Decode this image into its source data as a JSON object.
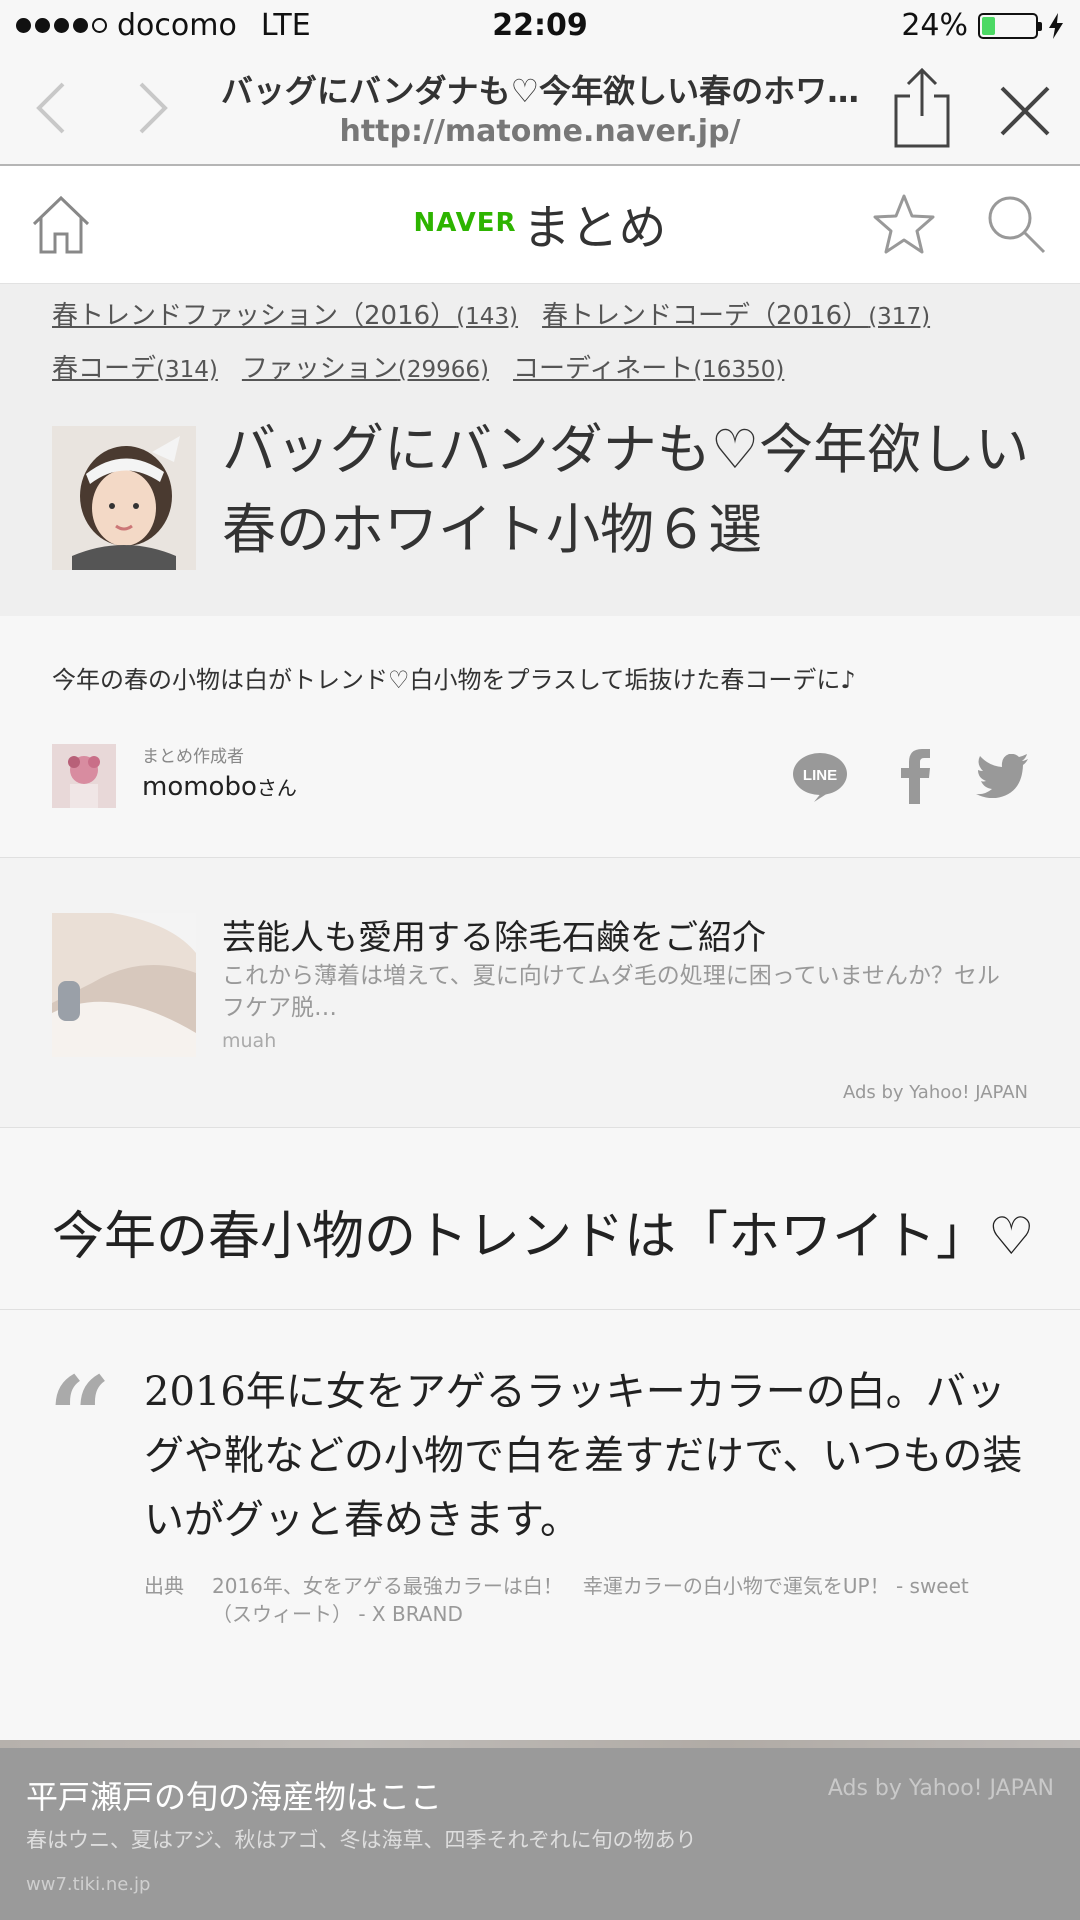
{
  "status_bar": {
    "carrier": "docomo",
    "network": "LTE",
    "time": "22:09",
    "battery_percent": "24%",
    "battery_level": 0.24,
    "signal_bars_filled": 4,
    "signal_bars_total": 5
  },
  "browser": {
    "page_title": "バッグにバンダナも♡今年欲しい春のホワ…",
    "url": "http://matome.naver.jp/"
  },
  "header": {
    "logo_naver": "NAVER",
    "logo_matome": "まとめ",
    "brand_color": "#2db400"
  },
  "tags": [
    {
      "label": "春トレンドファッション（2016）",
      "count": "(143)"
    },
    {
      "label": "春トレンドコーデ（2016）",
      "count": "(317)"
    },
    {
      "label": "春コーデ",
      "count": "(314)"
    },
    {
      "label": "ファッション",
      "count": "(29966)"
    },
    {
      "label": "コーディネート",
      "count": "(16350)"
    }
  ],
  "article": {
    "title": "バッグにバンダナも♡今年欲しい春のホワイト小物６選",
    "summary": "今年の春の小物は白がトレンド♡白小物をプラスして垢抜けた春コーデに♪",
    "author_role": "まとめ作成者",
    "author_name": "momobo",
    "author_suffix": "さん"
  },
  "share": {
    "line_label": "LINE"
  },
  "ad1": {
    "title": "芸能人も愛用する除毛石鹸をご紹介",
    "description": "これから薄着は増えて、夏に向けてムダ毛の処理に困っていませんか？セルフケア脱…",
    "source": "muah",
    "label": "Ads by Yahoo! JAPAN"
  },
  "section_heading": "今年の春小物のトレンドは「ホワイト」♡",
  "quote": {
    "mark": "“",
    "text": "2016年に女をアゲるラッキーカラーの白。バッグや靴などの小物で白を差すだけで、いつもの装いがグッと春めきます。",
    "source_label": "出典",
    "source_text": "2016年、女をアゲる最強カラーは白！　幸運カラーの白小物で運気をUP！ - sweet（スウィート） - X BRAND"
  },
  "bottom_ad": {
    "title": "平戸瀬戸の旬の海産物はここ",
    "label": "Ads by Yahoo! JAPAN",
    "description": "春はウニ、夏はアジ、秋はアゴ、冬は海草、四季それぞれに旬の物あり",
    "source": "ww7.tiki.ne.jp"
  }
}
